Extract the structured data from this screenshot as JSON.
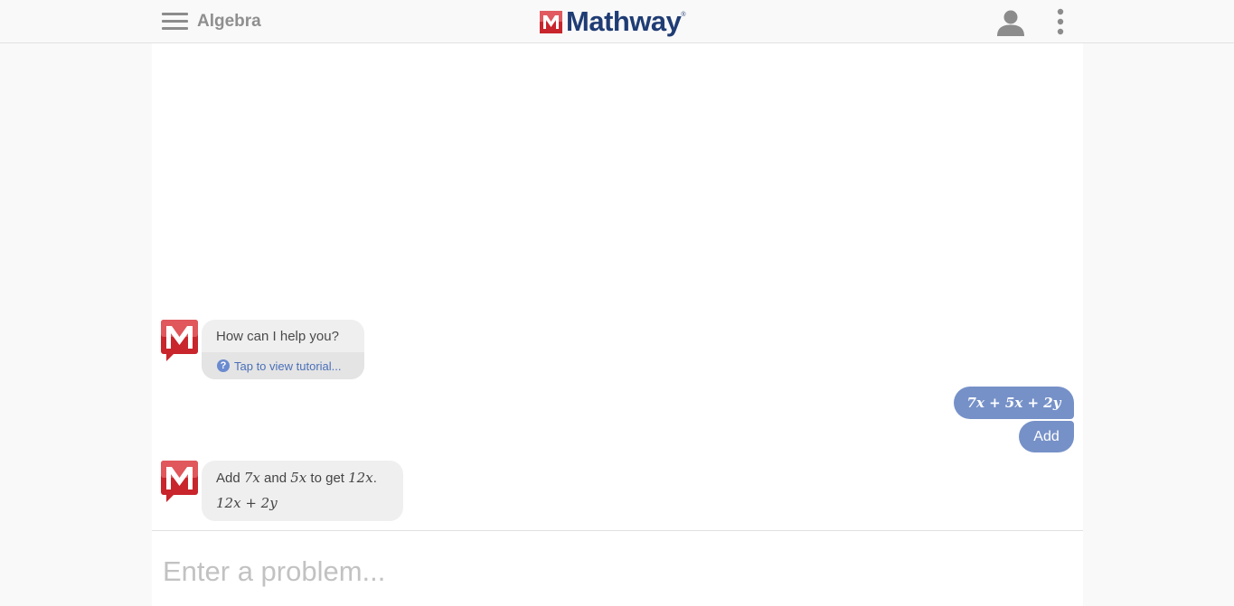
{
  "header": {
    "subject": "Algebra",
    "logo_text": "Mathway",
    "logo_tm": "®",
    "icons": [
      "hamburger-menu-icon",
      "user-icon",
      "more-vertical-icon"
    ]
  },
  "chat": {
    "greeting": "How can I help you?",
    "tutorial_link": "Tap to view tutorial...",
    "user_expression": "7x + 5x + 2y",
    "user_action": "Add",
    "answer": {
      "prefix": "Add ",
      "term_a": "7x",
      "mid": " and ",
      "term_b": "5x",
      "mid2": " to get ",
      "result": "12x",
      "suffix": ".",
      "final": "12x + 2y"
    }
  },
  "input": {
    "placeholder": "Enter a problem..."
  },
  "colors": {
    "brand_red": "#c8252c",
    "brand_navy": "#1f3c74",
    "user_bubble": "#7691c8",
    "bot_bubble": "#efefef"
  }
}
